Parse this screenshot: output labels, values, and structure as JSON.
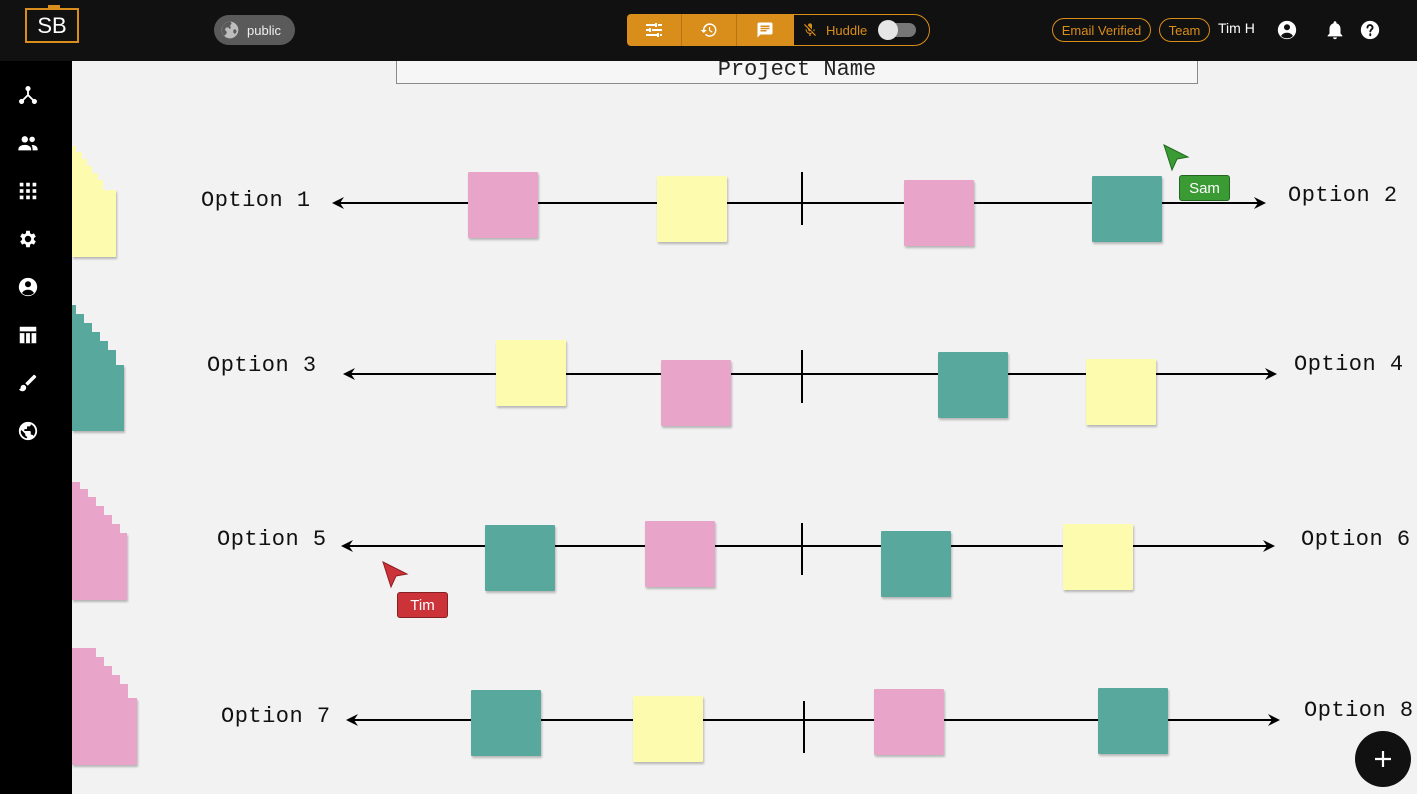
{
  "header": {
    "logo_text": "SB",
    "visibility_label": "public",
    "huddle_label": "Huddle",
    "email_badge": "Email Verified",
    "team_badge": "Team",
    "user_name": "Tim H"
  },
  "colors": {
    "accent": "#d98d1a",
    "pink": "#e8a5c9",
    "yellow": "#fdfbad",
    "teal": "#58a89d",
    "sam_cursor": "#3a9a34",
    "tim_cursor": "#cc3338"
  },
  "toolbar": {
    "icons": [
      "sliders-icon",
      "history-icon",
      "chat-icon"
    ]
  },
  "sidebar": {
    "icons": [
      "hierarchy-icon",
      "people-icon",
      "grid-icon",
      "gear-icon",
      "account-icon",
      "table-icon",
      "brush-icon",
      "globe-icon"
    ]
  },
  "board": {
    "project_name": "Project Name",
    "rows": [
      {
        "left": "Option 1",
        "right": "Option 2"
      },
      {
        "left": "Option 3",
        "right": "Option 4"
      },
      {
        "left": "Option 5",
        "right": "Option 6"
      },
      {
        "left": "Option 7",
        "right": "Option 8"
      }
    ],
    "cursors": {
      "sam": "Sam",
      "tim": "Tim"
    }
  }
}
